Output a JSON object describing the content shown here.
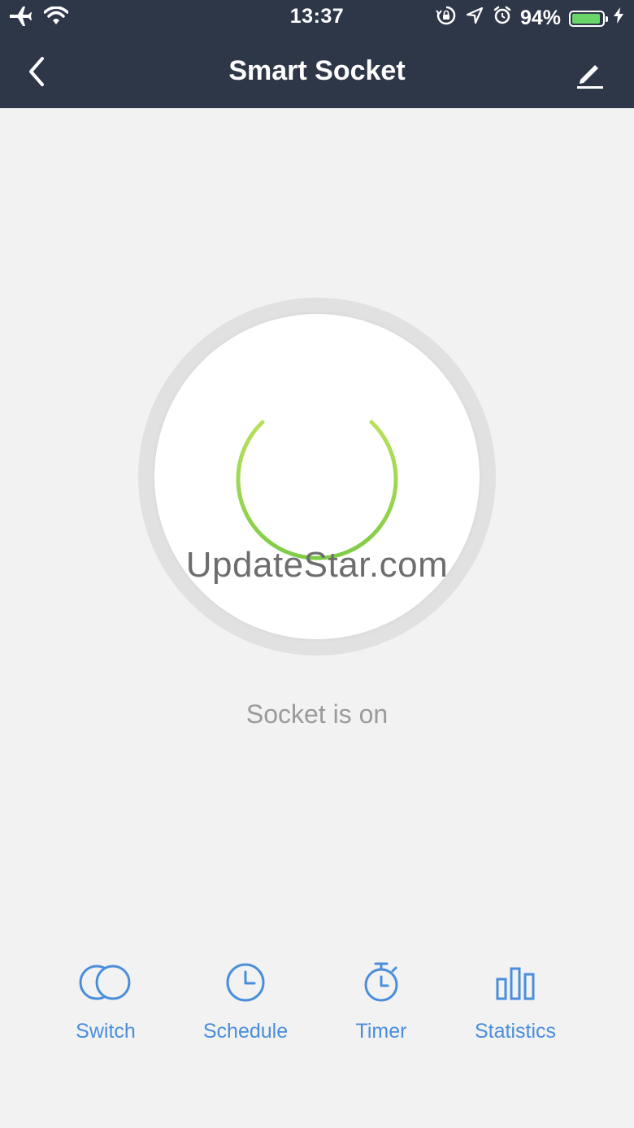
{
  "status_bar": {
    "time": "13:37",
    "battery_percent_text": "94%",
    "battery_level": 0.94,
    "left_icons": [
      "airplane-icon",
      "wifi-icon"
    ],
    "right_icons": [
      "rotation-lock-icon",
      "location-arrow-icon",
      "alarm-icon",
      "battery-icon",
      "charging-bolt-icon"
    ]
  },
  "nav": {
    "title": "Smart Socket",
    "back_icon": "chevron-left-icon",
    "edit_icon": "pencil-edit-icon"
  },
  "power": {
    "state": "on",
    "state_text": "Socket is on",
    "icon_color": "#8fd14f"
  },
  "watermark": "UpdateStar.com",
  "actions": [
    {
      "label": "Switch",
      "icon": "switch-circles-icon"
    },
    {
      "label": "Schedule",
      "icon": "clock-icon"
    },
    {
      "label": "Timer",
      "icon": "stopwatch-icon"
    },
    {
      "label": "Statistics",
      "icon": "bar-chart-icon"
    }
  ],
  "colors": {
    "header_bg": "#2e3748",
    "accent_blue": "#4a8edb",
    "power_green": "#8fd14f",
    "background": "#f2f2f2"
  }
}
